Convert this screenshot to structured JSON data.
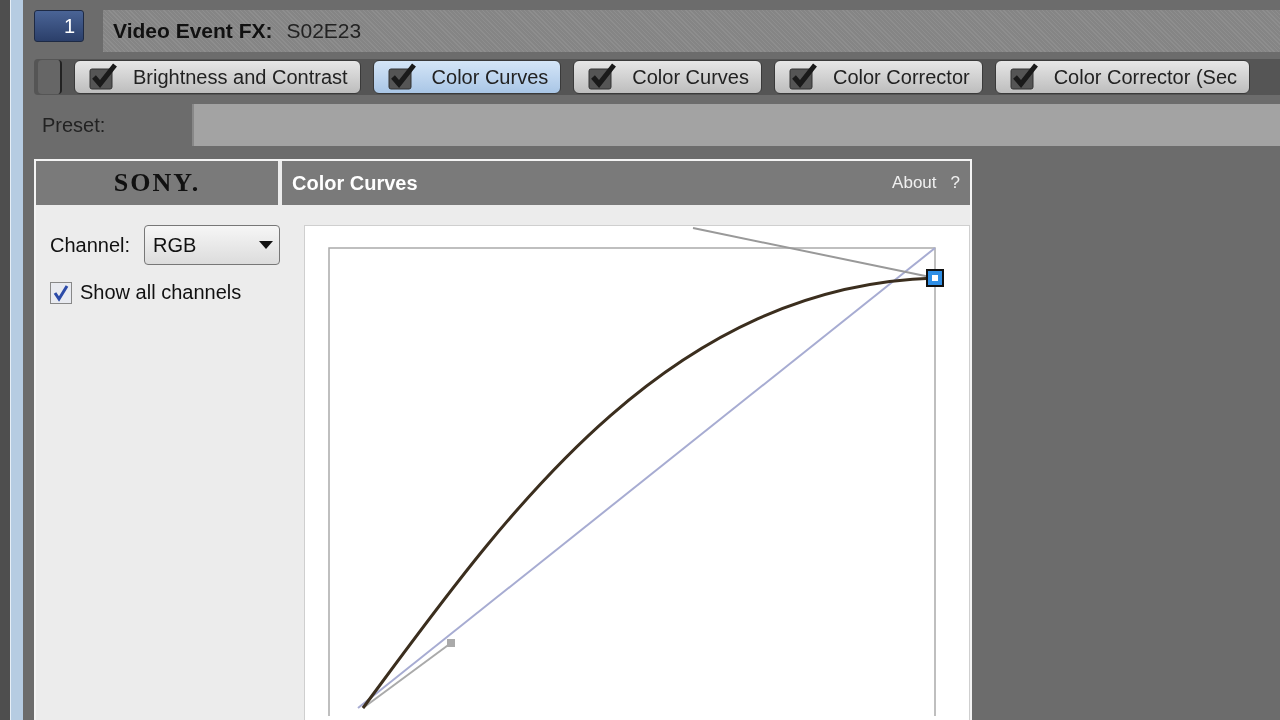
{
  "track_button": {
    "label": "1"
  },
  "header": {
    "label": "Video Event FX:",
    "value": "S02E23"
  },
  "fx_chain": [
    {
      "label": "Brightness and Contrast",
      "enabled": true,
      "selected": false
    },
    {
      "label": "Color Curves",
      "enabled": true,
      "selected": true
    },
    {
      "label": "Color Curves",
      "enabled": true,
      "selected": false
    },
    {
      "label": "Color Corrector",
      "enabled": true,
      "selected": false
    },
    {
      "label": "Color Corrector (Sec",
      "enabled": true,
      "selected": false
    }
  ],
  "preset": {
    "label": "Preset:"
  },
  "plugin": {
    "logo": "SONY.",
    "title": "Color Curves",
    "about": "About",
    "help": "?",
    "channel": {
      "label": "Channel:",
      "value": "RGB"
    },
    "show_all_channels": {
      "label": "Show all channels",
      "checked": true
    }
  }
}
